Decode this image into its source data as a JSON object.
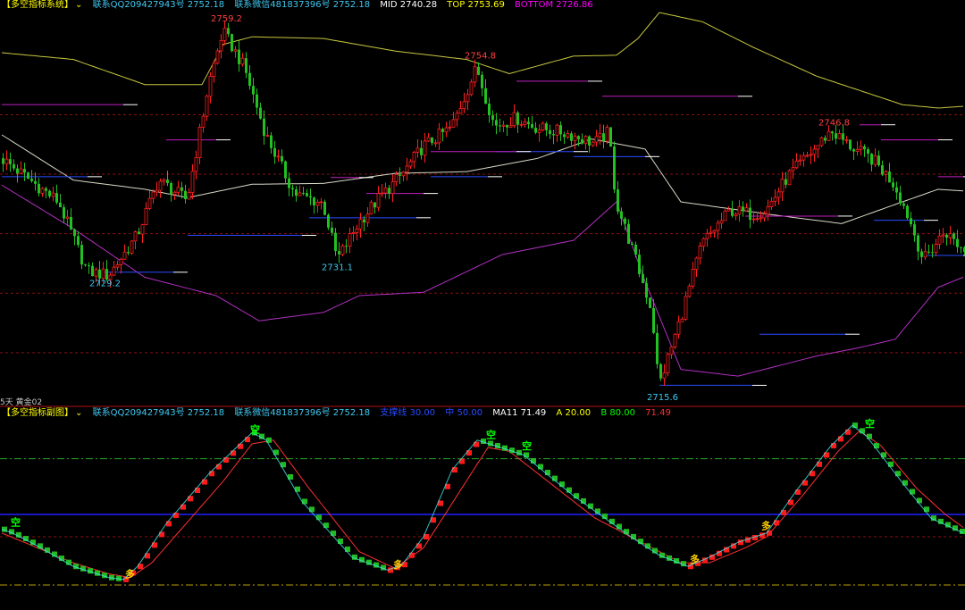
{
  "colors": {
    "background": "#000000",
    "up_candle": "#ff2020",
    "down_candle": "#22c022",
    "upper_band": "#c8c840",
    "mid_band": "#d8d8c8",
    "lower_band": "#b030c0",
    "blue_level": "#2a4bff",
    "grid_red": "#8a1010",
    "sub_red_line": "#ff3030",
    "sub_cyan_line": "#40e0e0",
    "sub_blue_line": "#2020ff",
    "sub_green_dash": "#22aa22",
    "sub_yellow_dash": "#b8a000"
  },
  "main_header": {
    "title": "【多空指标系统】",
    "qq": "联系QQ209427943号 2752.18",
    "wechat": "联系微信481837396号 2752.18",
    "mid": "MID 2740.28",
    "top": "TOP 2753.69",
    "bottom": "BOTTOM 2726.86"
  },
  "sub_header": {
    "title": "【多空指标副图】",
    "qq": "联系QQ209427943号 2752.18",
    "wechat": "联系微信481837396号 2752.18",
    "line1": "支撑线 30.00",
    "line2": "中 50.00",
    "ma": "MA11 71.49",
    "a": "A 20.00",
    "b": "B 80.00",
    "value": "71.49"
  },
  "corner_label": "5天 黄金02",
  "chart_data": [
    {
      "type": "candlestick",
      "title": "【多空指标系统】",
      "ylim": [
        2713.8,
        2760.6
      ],
      "series_summary": {
        "MID": 2740.28,
        "TOP": 2753.69,
        "BOTTOM": 2726.86
      },
      "price_labels": [
        {
          "text": "2759.2",
          "bar": 62,
          "price": 2759.2,
          "pos": "above"
        },
        {
          "text": "2754.8",
          "bar": 133,
          "price": 2754.8,
          "pos": "above"
        },
        {
          "text": "2746.8",
          "bar": 232,
          "price": 2746.8,
          "pos": "above"
        },
        {
          "text": "2729.2",
          "bar": 28,
          "price": 2729.2,
          "pos": "below"
        },
        {
          "text": "2731.1",
          "bar": 93,
          "price": 2731.1,
          "pos": "below"
        },
        {
          "text": "2715.6",
          "bar": 184,
          "price": 2715.6,
          "pos": "below"
        }
      ],
      "red_grid_levels": [
        2748.4,
        2741.3,
        2734.2,
        2727.1,
        2720.0
      ],
      "candle_path": [
        [
          0,
          2743.2
        ],
        [
          8,
          2740.6
        ],
        [
          16,
          2738.0
        ],
        [
          24,
          2729.7
        ],
        [
          30,
          2729.2
        ],
        [
          38,
          2734.0
        ],
        [
          44,
          2740.6
        ],
        [
          52,
          2738.2
        ],
        [
          58,
          2752.0
        ],
        [
          62,
          2758.4
        ],
        [
          68,
          2754.0
        ],
        [
          74,
          2746.0
        ],
        [
          82,
          2739.0
        ],
        [
          90,
          2737.8
        ],
        [
          94,
          2731.1
        ],
        [
          100,
          2735.5
        ],
        [
          106,
          2738.6
        ],
        [
          112,
          2741.2
        ],
        [
          118,
          2744.6
        ],
        [
          126,
          2746.9
        ],
        [
          133,
          2754.0
        ],
        [
          138,
          2747.0
        ],
        [
          144,
          2748.0
        ],
        [
          150,
          2746.8
        ],
        [
          158,
          2746.2
        ],
        [
          166,
          2745.0
        ],
        [
          170,
          2746.3
        ],
        [
          172,
          2738.0
        ],
        [
          176,
          2733.0
        ],
        [
          182,
          2725.0
        ],
        [
          184,
          2716.0
        ],
        [
          190,
          2724.0
        ],
        [
          196,
          2733.0
        ],
        [
          204,
          2737.0
        ],
        [
          210,
          2736.5
        ],
        [
          214,
          2737.0
        ],
        [
          220,
          2741.0
        ],
        [
          228,
          2744.5
        ],
        [
          232,
          2746.5
        ],
        [
          238,
          2744.5
        ],
        [
          244,
          2743.0
        ],
        [
          250,
          2740.0
        ],
        [
          254,
          2736.0
        ],
        [
          258,
          2731.0
        ],
        [
          264,
          2734.5
        ],
        [
          269,
          2732.3
        ]
      ],
      "upper_band": [
        [
          0,
          2755.8
        ],
        [
          20,
          2755.0
        ],
        [
          40,
          2752.0
        ],
        [
          56,
          2752.0
        ],
        [
          62,
          2756.8
        ],
        [
          70,
          2757.7
        ],
        [
          90,
          2757.5
        ],
        [
          110,
          2756.0
        ],
        [
          130,
          2755.0
        ],
        [
          142,
          2753.3
        ],
        [
          160,
          2755.4
        ],
        [
          172,
          2755.5
        ],
        [
          178,
          2757.5
        ],
        [
          184,
          2760.6
        ],
        [
          196,
          2759.5
        ],
        [
          210,
          2756.5
        ],
        [
          228,
          2753.0
        ],
        [
          240,
          2751.3
        ],
        [
          252,
          2749.6
        ],
        [
          262,
          2749.2
        ],
        [
          269,
          2749.4
        ]
      ],
      "mid_band": [
        [
          0,
          2746.0
        ],
        [
          20,
          2740.6
        ],
        [
          40,
          2739.5
        ],
        [
          52,
          2738.5
        ],
        [
          70,
          2740.1
        ],
        [
          90,
          2740.2
        ],
        [
          110,
          2741.4
        ],
        [
          130,
          2741.6
        ],
        [
          150,
          2743.2
        ],
        [
          165,
          2745.5
        ],
        [
          180,
          2744.3
        ],
        [
          190,
          2738.0
        ],
        [
          200,
          2737.4
        ],
        [
          215,
          2736.5
        ],
        [
          235,
          2735.4
        ],
        [
          252,
          2738.0
        ],
        [
          262,
          2739.5
        ],
        [
          269,
          2739.3
        ]
      ],
      "lower_band": [
        [
          0,
          2740.0
        ],
        [
          20,
          2734.8
        ],
        [
          40,
          2729.0
        ],
        [
          60,
          2726.8
        ],
        [
          72,
          2723.8
        ],
        [
          90,
          2724.8
        ],
        [
          100,
          2726.8
        ],
        [
          118,
          2727.2
        ],
        [
          140,
          2731.7
        ],
        [
          160,
          2733.4
        ],
        [
          172,
          2738.0
        ],
        [
          180,
          2728.5
        ],
        [
          190,
          2718.0
        ],
        [
          206,
          2717.2
        ],
        [
          228,
          2719.6
        ],
        [
          240,
          2720.6
        ],
        [
          250,
          2721.6
        ],
        [
          262,
          2727.8
        ],
        [
          269,
          2729.0
        ]
      ],
      "blue_levels": [
        {
          "from": 0,
          "to": 24,
          "price": 2741.0
        },
        {
          "from": 28,
          "to": 48,
          "price": 2729.6
        },
        {
          "from": 52,
          "to": 84,
          "price": 2734.0
        },
        {
          "from": 86,
          "to": 116,
          "price": 2736.1
        },
        {
          "from": 120,
          "to": 136,
          "price": 2741.0
        },
        {
          "from": 138,
          "to": 160,
          "price": 2744.0
        },
        {
          "from": 160,
          "to": 180,
          "price": 2743.4
        },
        {
          "from": 184,
          "to": 210,
          "price": 2716.1
        },
        {
          "from": 212,
          "to": 236,
          "price": 2722.2
        },
        {
          "from": 244,
          "to": 258,
          "price": 2735.8
        },
        {
          "from": 258,
          "to": 269,
          "price": 2731.6
        }
      ],
      "magenta_levels": [
        {
          "from": 0,
          "to": 34,
          "price": 2749.6
        },
        {
          "from": 46,
          "to": 60,
          "price": 2745.4
        },
        {
          "from": 92,
          "to": 100,
          "price": 2740.9
        },
        {
          "from": 102,
          "to": 118,
          "price": 2739.0
        },
        {
          "from": 120,
          "to": 144,
          "price": 2744.0
        },
        {
          "from": 144,
          "to": 164,
          "price": 2752.4
        },
        {
          "from": 168,
          "to": 206,
          "price": 2750.6
        },
        {
          "from": 208,
          "to": 234,
          "price": 2736.3
        },
        {
          "from": 240,
          "to": 246,
          "price": 2747.2
        },
        {
          "from": 246,
          "to": 262,
          "price": 2745.4
        },
        {
          "from": 262,
          "to": 269,
          "price": 2741.0
        }
      ]
    },
    {
      "type": "line",
      "title": "【多空指标副图】",
      "ylim": [
        0,
        100
      ],
      "levels": {
        "A": 20,
        "B": 80,
        "mid": 50,
        "support": 30
      },
      "current": {
        "MA11": 71.49,
        "value": 71.49
      },
      "main_line": [
        [
          0,
          42
        ],
        [
          3,
          40
        ],
        [
          10,
          33
        ],
        [
          20,
          22
        ],
        [
          30,
          16
        ],
        [
          34,
          15
        ],
        [
          38,
          22
        ],
        [
          46,
          45
        ],
        [
          58,
          72
        ],
        [
          70,
          94
        ],
        [
          74,
          90
        ],
        [
          84,
          57
        ],
        [
          98,
          27
        ],
        [
          108,
          20
        ],
        [
          112,
          23
        ],
        [
          118,
          38
        ],
        [
          126,
          74
        ],
        [
          133,
          90
        ],
        [
          138,
          87
        ],
        [
          146,
          82
        ],
        [
          160,
          60
        ],
        [
          176,
          38
        ],
        [
          184,
          28
        ],
        [
          192,
          22
        ],
        [
          198,
          27
        ],
        [
          206,
          35
        ],
        [
          214,
          40
        ],
        [
          222,
          62
        ],
        [
          232,
          87
        ],
        [
          238,
          98
        ],
        [
          242,
          92
        ],
        [
          252,
          67
        ],
        [
          260,
          48
        ],
        [
          269,
          40
        ]
      ],
      "signal_line": [
        [
          0,
          40
        ],
        [
          10,
          32
        ],
        [
          20,
          24
        ],
        [
          30,
          18
        ],
        [
          36,
          16
        ],
        [
          42,
          24
        ],
        [
          52,
          46
        ],
        [
          62,
          68
        ],
        [
          70,
          88
        ],
        [
          76,
          90
        ],
        [
          86,
          64
        ],
        [
          100,
          30
        ],
        [
          110,
          21
        ],
        [
          118,
          32
        ],
        [
          128,
          62
        ],
        [
          136,
          86
        ],
        [
          142,
          84
        ],
        [
          154,
          66
        ],
        [
          166,
          48
        ],
        [
          178,
          36
        ],
        [
          190,
          24
        ],
        [
          198,
          24
        ],
        [
          208,
          32
        ],
        [
          214,
          38
        ],
        [
          224,
          60
        ],
        [
          234,
          84
        ],
        [
          240,
          95
        ],
        [
          246,
          87
        ],
        [
          256,
          64
        ],
        [
          264,
          50
        ],
        [
          269,
          43
        ]
      ],
      "markers": [
        {
          "text": "空",
          "bar": 4,
          "value": 46,
          "color": "#00ff00"
        },
        {
          "text": "多",
          "bar": 36,
          "value": 18,
          "color": "#ffd000"
        },
        {
          "text": "空",
          "bar": 71,
          "value": 96,
          "color": "#00ff00"
        },
        {
          "text": "多",
          "bar": 111,
          "value": 23,
          "color": "#ffd000"
        },
        {
          "text": "空",
          "bar": 137,
          "value": 93,
          "color": "#00ff00"
        },
        {
          "text": "空",
          "bar": 147,
          "value": 87,
          "color": "#00ff00"
        },
        {
          "text": "多",
          "bar": 194,
          "value": 26,
          "color": "#ffd000"
        },
        {
          "text": "多",
          "bar": 214,
          "value": 44,
          "color": "#ffd000"
        },
        {
          "text": "空",
          "bar": 243,
          "value": 99,
          "color": "#00ff00"
        }
      ]
    }
  ]
}
